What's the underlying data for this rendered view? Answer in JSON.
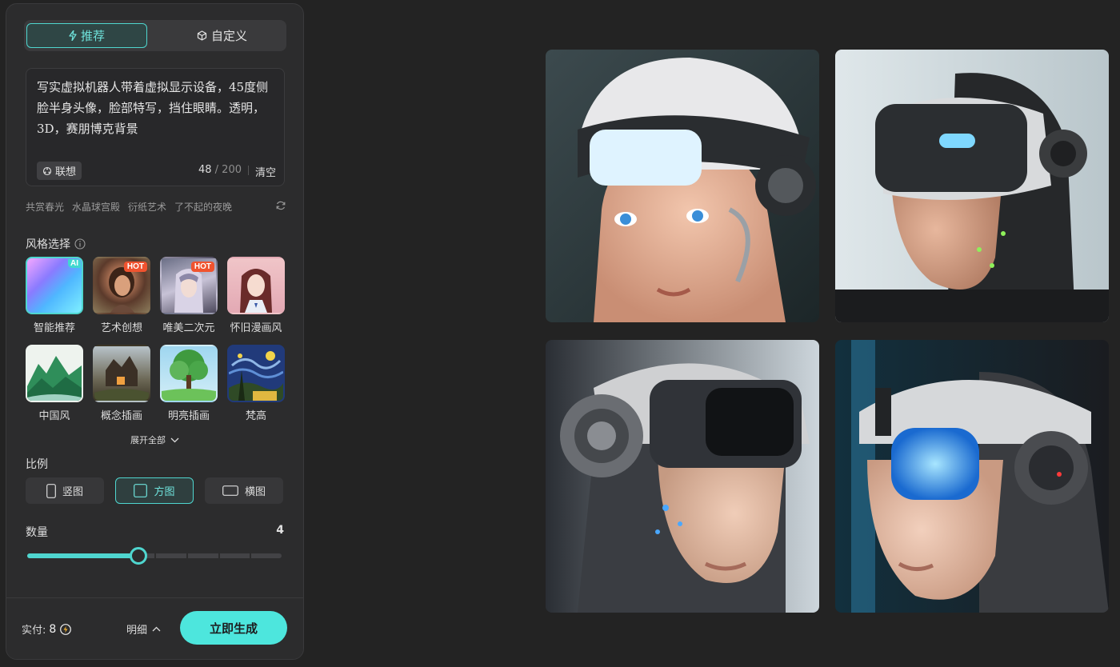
{
  "tabs": {
    "recommend": "推荐",
    "custom": "自定义"
  },
  "prompt": {
    "text": "写实虚拟机器人带着虚拟显示设备，45度侧脸半身头像，脸部特写，挡住眼睛。透明，3D，赛朋博克背景",
    "associate_label": "联想",
    "count_current": "48",
    "count_max": "/ 200",
    "clear_label": "清空"
  },
  "suggestions": [
    "共赏春光",
    "水晶球宫殿",
    "衍纸艺术",
    "了不起的夜晚"
  ],
  "style_section": {
    "title": "风格选择",
    "items": [
      {
        "label": "智能推荐",
        "badge": "AI"
      },
      {
        "label": "艺术创想",
        "badge": "HOT"
      },
      {
        "label": "唯美二次元",
        "badge": "HOT"
      },
      {
        "label": "怀旧漫画风",
        "badge": ""
      },
      {
        "label": "中国风",
        "badge": ""
      },
      {
        "label": "概念插画",
        "badge": ""
      },
      {
        "label": "明亮插画",
        "badge": ""
      },
      {
        "label": "梵高",
        "badge": ""
      }
    ],
    "expand_label": "展开全部"
  },
  "ratio_section": {
    "title": "比例",
    "options": [
      "竖图",
      "方图",
      "横图"
    ],
    "selected": "方图"
  },
  "quantity_section": {
    "title": "数量",
    "value": "4",
    "level": 4,
    "max": 8
  },
  "footer": {
    "pay_label": "实付:",
    "pay_amount": "8",
    "detail_label": "明细",
    "generate_label": "立即生成"
  },
  "colors": {
    "accent": "#4fd6cf",
    "background": "#232323",
    "panel": "#2c2c2d",
    "hot_badge": "#f0532f"
  },
  "icons": {
    "recommend_tab": "lightning-icon",
    "custom_tab": "cube-icon",
    "associate": "sparkle-icon",
    "refresh": "refresh-icon",
    "info": "info-icon",
    "expand": "chevron-down-icon",
    "cost": "lightning-coin-icon",
    "detail": "chevron-up-icon"
  }
}
